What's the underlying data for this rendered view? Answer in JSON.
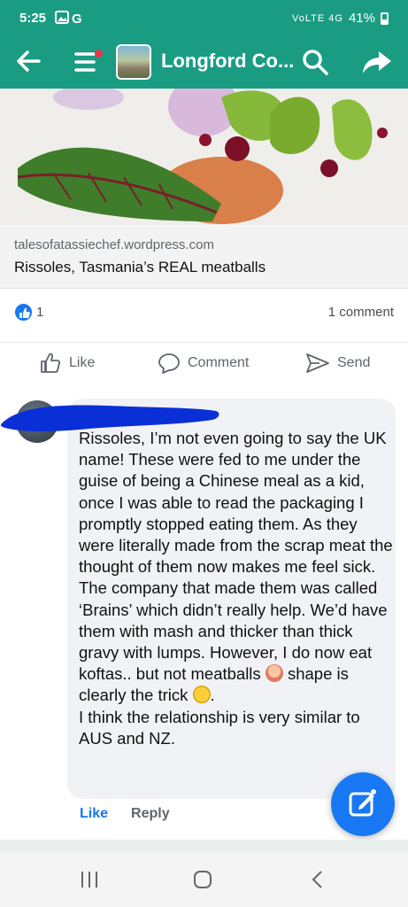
{
  "status_bar": {
    "time": "5:25",
    "left_icons": "gallery-icon google-icon",
    "network": "VoLTE 4G",
    "battery": "41%"
  },
  "app_bar": {
    "title": "Longford Co...",
    "accent": "#1a9c83",
    "notification_dot": "#e8334a"
  },
  "link_preview": {
    "domain": "talesofatassiechef.wordpress.com",
    "title": "Rissoles, Tasmania’s REAL meatballs"
  },
  "reactions": {
    "like_count": "1",
    "comment_count": "1 comment"
  },
  "actions": {
    "like": "Like",
    "comment": "Comment",
    "send": "Send"
  },
  "comment": {
    "text_1": "Rissoles, I’m not even going to say the UK name! These were fed to me under the guise of being a Chinese meal as a kid, once I was able to read the packaging I promptly stopped eating them. As they were literally made from the scrap meat the thought of them now makes me feel sick. The company that made them was called ‘Brains’ which didn’t really help. We’d have them with mash and thicker than thick gravy with lumps. However, I do now eat koftas.. but not meatballs ",
    "text_2": " shape is clearly the trick ",
    "text_3": ".\nI think the relationship is very similar to AUS and NZ.",
    "emoji_1": "woman-shrugging-emoji",
    "emoji_2": "laughing-emoji",
    "like_label": "Like",
    "reply_label": "Reply"
  },
  "colors": {
    "like_blue": "#1877f2",
    "bubble": "#f0f2f5"
  }
}
